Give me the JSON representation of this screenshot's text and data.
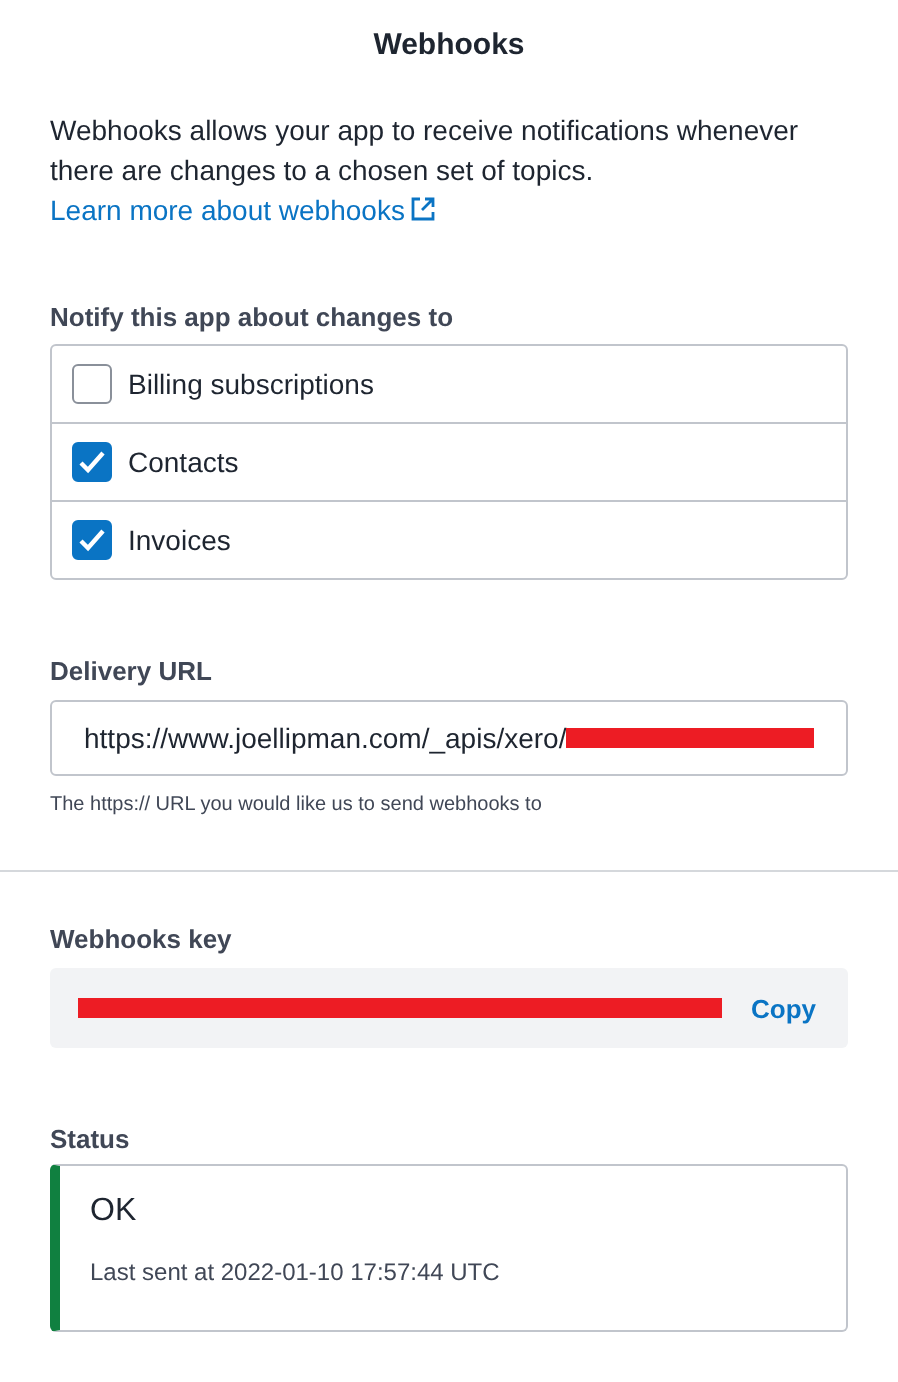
{
  "title": "Webhooks",
  "intro": {
    "text": "Webhooks allows your app to receive notifications whenever there are changes to a chosen set of topics.",
    "link": "Learn more about webhooks"
  },
  "topics": {
    "label": "Notify this app about changes to",
    "items": [
      {
        "label": "Billing subscriptions",
        "checked": false
      },
      {
        "label": "Contacts",
        "checked": true
      },
      {
        "label": "Invoices",
        "checked": true
      }
    ]
  },
  "delivery_url": {
    "label": "Delivery URL",
    "value": "https://www.joellipman.com/_apis/xero/",
    "redacted": true,
    "hint": "The https:// URL you would like us to send webhooks to"
  },
  "webhooks_key": {
    "label": "Webhooks key",
    "redacted": true,
    "button": "Copy"
  },
  "status": {
    "label": "Status",
    "state": "OK",
    "ok": true,
    "detail": "Last sent at 2022-01-10 17:57:44 UTC"
  }
}
